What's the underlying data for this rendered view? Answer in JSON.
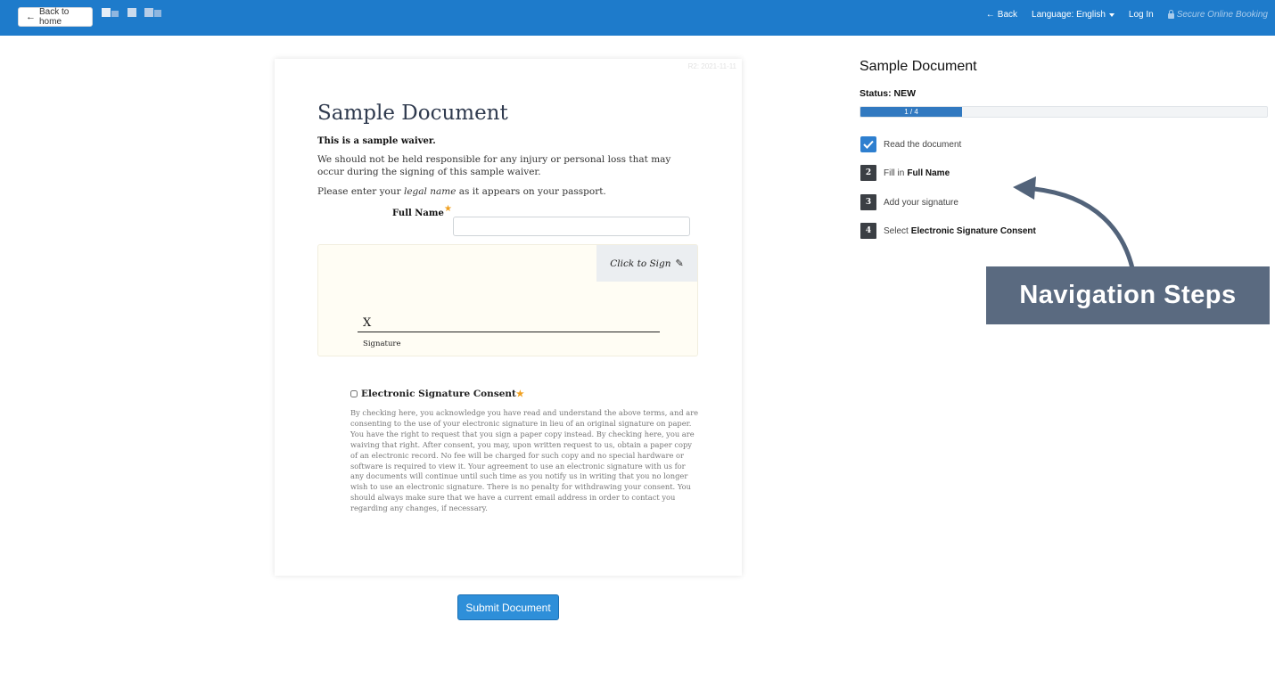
{
  "header": {
    "back_home_label": "Back to home",
    "back_label": "Back",
    "language_label": "Language: English",
    "login_label": "Log In",
    "secure_label": "Secure Online Booking"
  },
  "document": {
    "ref": "R2: 2021-11-11",
    "title": "Sample Document",
    "p1": "This is a sample waiver.",
    "p2": "We should not be held responsible for any injury or personal loss that may occur during the signing of this sample waiver.",
    "p3_pre": "Please enter your ",
    "p3_em": "legal name",
    "p3_post": " as it appears on your passport.",
    "full_name_label": "Full Name",
    "full_name_value": "",
    "required_star": "★",
    "click_to_sign": "Click to Sign",
    "signature_x": "X",
    "signature_label": "Signature",
    "consent_label": "Electronic Signature Consent",
    "consent_text": "By checking here, you acknowledge you have read and understand the above terms, and are consenting to the use of your electronic signature in lieu of an original signature on paper. You have the right to request that you sign a paper copy instead. By checking here, you are waiving that right. After consent, you may, upon written request to us, obtain a paper copy of an electronic record. No fee will be charged for such copy and no special hardware or software is required to view it. Your agreement to use an electronic signature with us for any documents will continue until such time as you notify us in writing that you no longer wish to use an electronic signature. There is no penalty for withdrawing your consent. You should always make sure that we have a current email address in order to contact you regarding any changes, if necessary."
  },
  "submit_label": "Submit Document",
  "panel": {
    "title": "Sample Document",
    "status": "Status: NEW",
    "progress_text": "1 / 4",
    "progress_fraction": 0.25,
    "steps": [
      {
        "num": "",
        "text": "Read the document",
        "bold": "",
        "done": true
      },
      {
        "num": "2",
        "text": "Fill in",
        "bold": "Full Name",
        "done": false
      },
      {
        "num": "3",
        "text": "Add your signature",
        "bold": "",
        "done": false
      },
      {
        "num": "4",
        "text": "Select",
        "bold": "Electronic Signature Consent",
        "done": false
      }
    ]
  },
  "callout_label": "Navigation Steps",
  "colors": {
    "header": "#1e7bcb",
    "accent": "#2e8fd9",
    "callout": "#5a6a80"
  }
}
